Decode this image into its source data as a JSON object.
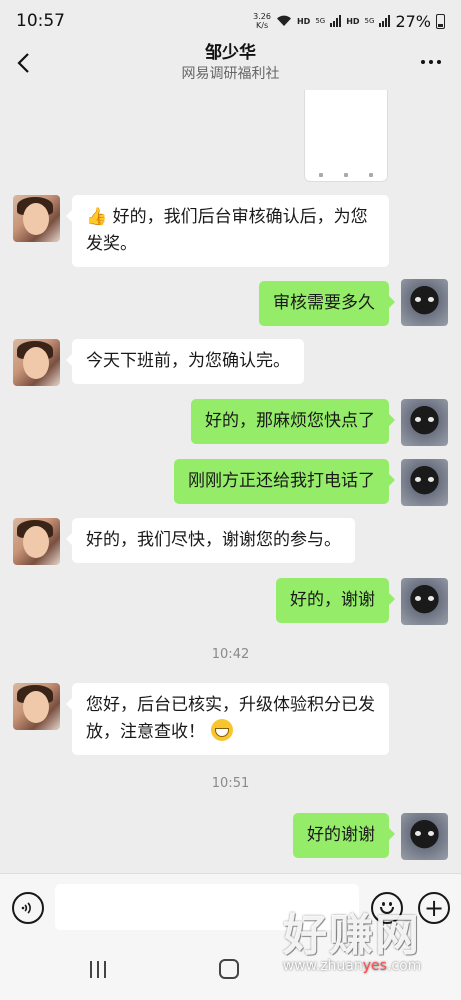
{
  "status_bar": {
    "time": "10:57",
    "net_speed_value": "3.26",
    "net_speed_unit": "K/s",
    "hd1": "HD",
    "signal1": "5G",
    "hd2": "HD",
    "signal2": "5G",
    "battery": "27%"
  },
  "header": {
    "title": "邹少华",
    "subtitle": "网易调研福利社"
  },
  "messages": [
    {
      "side": "left",
      "text": "好的，我们后台审核确认后，为您发奖。",
      "lead_emoji": "thumbs-up"
    },
    {
      "side": "right",
      "text": "审核需要多久"
    },
    {
      "side": "left",
      "text": "今天下班前，为您确认完。"
    },
    {
      "side": "right",
      "text": "好的，那麻烦您快点了"
    },
    {
      "side": "right",
      "text": "刚刚方正还给我打电话了"
    },
    {
      "side": "left",
      "text": "好的，我们尽快，谢谢您的参与。"
    },
    {
      "side": "right",
      "text": "好的，谢谢"
    },
    {
      "side": "left",
      "text": "您好，后台已核实，升级体验积分已发放，注意查收！",
      "trail_emoji": "grinning-face"
    },
    {
      "side": "right",
      "text": "好的谢谢"
    }
  ],
  "timestamps": [
    "10:42",
    "10:51"
  ],
  "input": {
    "placeholder": "",
    "value": ""
  },
  "watermark": {
    "big": "好赚网",
    "small_pre": "www.zhuan",
    "small_mid": "yes",
    "small_post": ".com"
  },
  "colors": {
    "sent_bubble": "#95ec69",
    "recv_bubble": "#ffffff",
    "background": "#ededed"
  }
}
